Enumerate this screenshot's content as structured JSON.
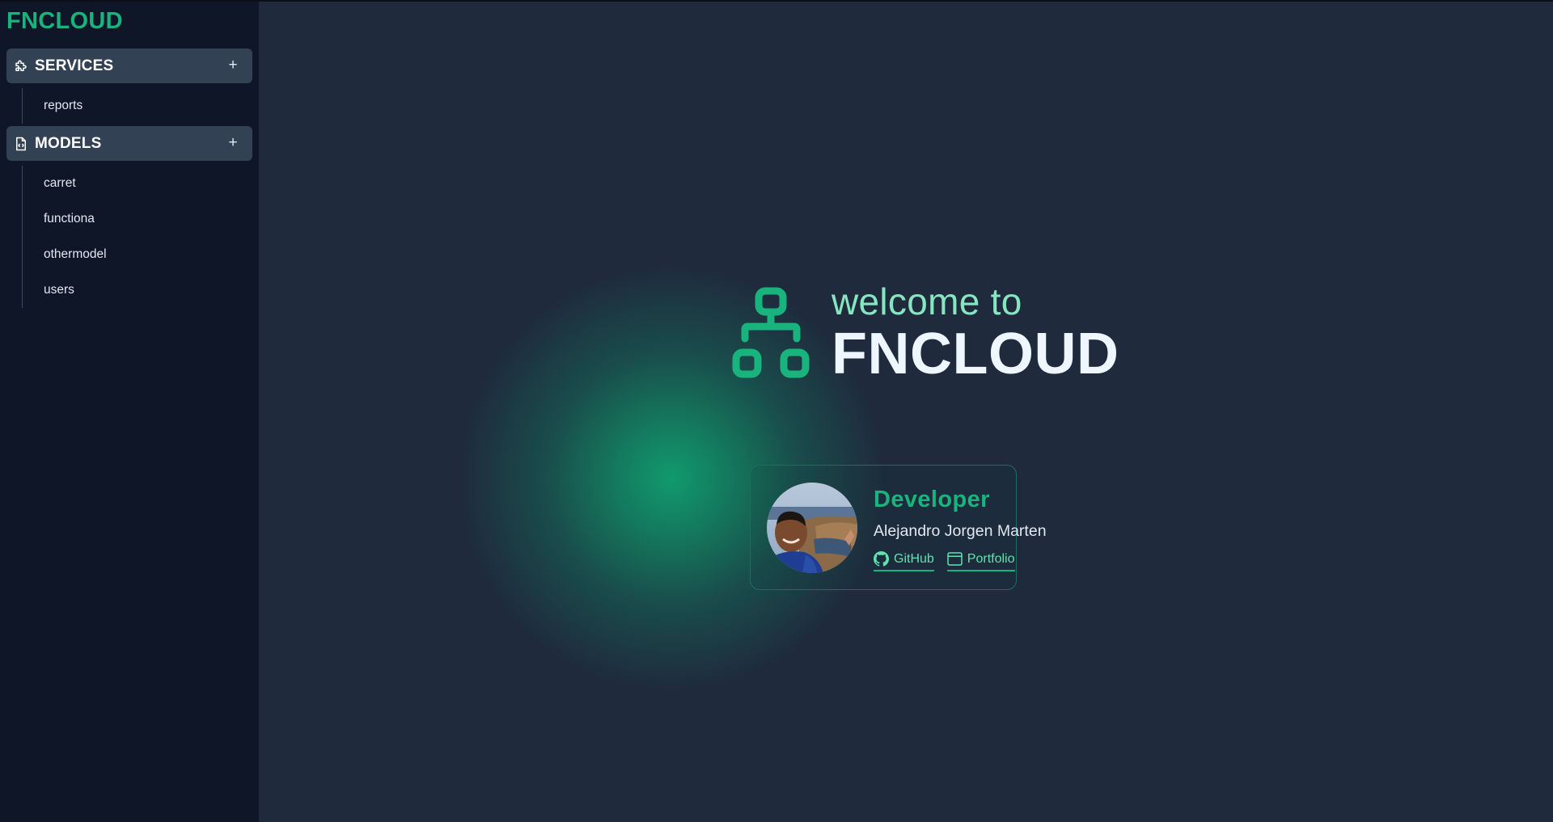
{
  "app": {
    "brand": "FNCLOUD"
  },
  "sidebar": {
    "services": {
      "title": "SERVICES",
      "icon": "puzzle-icon",
      "add_icon": "+",
      "items": [
        {
          "label": "reports"
        }
      ]
    },
    "models": {
      "title": "MODELS",
      "icon": "document-code-icon",
      "add_icon": "+",
      "items": [
        {
          "label": "carret"
        },
        {
          "label": "functiona"
        },
        {
          "label": "othermodel"
        },
        {
          "label": "users"
        }
      ]
    }
  },
  "hero": {
    "welcome": "welcome to",
    "title": "FNCLOUD",
    "logo_icon": "network-hierarchy-icon"
  },
  "developer": {
    "role": "Developer",
    "name": "Alejandro Jorgen Marten",
    "avatar": "developer-avatar-photo",
    "links": [
      {
        "label": "GitHub",
        "icon": "github-icon"
      },
      {
        "label": "Portfolio",
        "icon": "browser-window-icon"
      }
    ]
  },
  "colors": {
    "accent": "#19b37e",
    "accent_light": "#86e6bf",
    "sidebar_bg": "#0e1628",
    "main_bg": "#1f2a3c",
    "section_header_bg": "#334155"
  }
}
